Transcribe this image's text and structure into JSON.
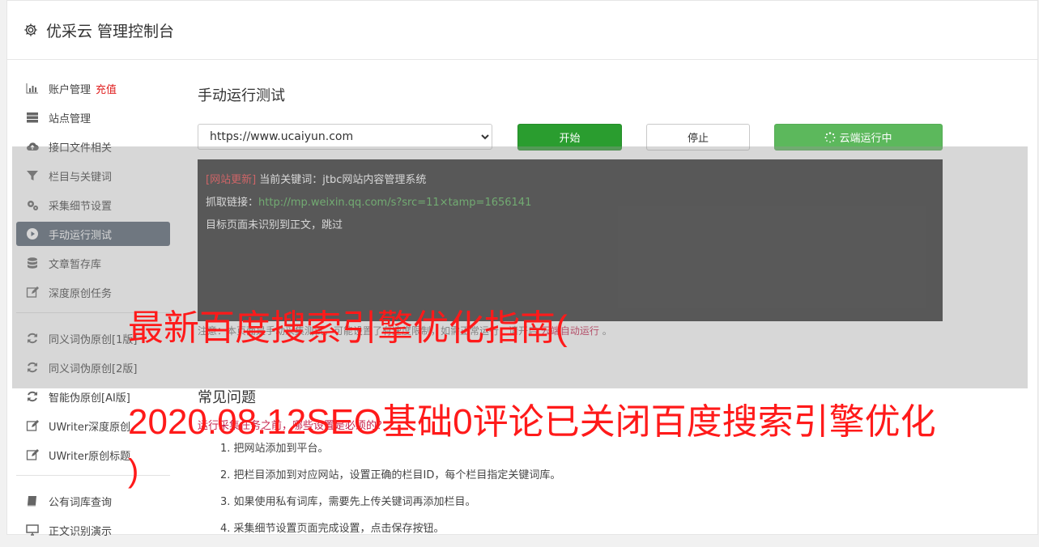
{
  "header": {
    "title": "优采云 管理控制台"
  },
  "sidebar": {
    "group1": [
      {
        "label": "账户管理",
        "extra": "充值",
        "icon": "bar-chart-icon"
      },
      {
        "label": "站点管理",
        "icon": "server-icon"
      },
      {
        "label": "接口文件相关",
        "icon": "cloud-upload-icon"
      },
      {
        "label": "栏目与关键词",
        "icon": "filter-icon"
      },
      {
        "label": "采集细节设置",
        "icon": "gears-icon"
      },
      {
        "label": "手动运行测试",
        "icon": "play-circle-icon",
        "active": true
      },
      {
        "label": "文章暂存库",
        "icon": "database-icon"
      },
      {
        "label": "深度原创任务",
        "icon": "edit-icon"
      }
    ],
    "group2": [
      {
        "label": "同义词伪原创[1版]",
        "icon": "refresh-icon"
      },
      {
        "label": "同义词伪原创[2版]",
        "icon": "refresh-icon"
      },
      {
        "label": "智能伪原创[AI版]",
        "icon": "refresh-icon"
      },
      {
        "label": "UWriter深度原创",
        "icon": "edit-icon"
      },
      {
        "label": "UWriter原创标题",
        "icon": "edit-icon"
      }
    ],
    "group3": [
      {
        "label": "公有词库查询",
        "icon": "book-icon"
      },
      {
        "label": "正文识别演示",
        "icon": "monitor-icon"
      }
    ]
  },
  "main": {
    "title": "手动运行测试",
    "site_select": {
      "value": "https://www.ucaiyun.com",
      "options": [
        "https://www.ucaiyun.com"
      ]
    },
    "buttons": {
      "start": "开始",
      "stop": "停止",
      "cloud": "云端运行中"
    },
    "console": {
      "line1_tag": "[网站更新]",
      "line1_text": " 当前关键词：jtbc网站内容管理系统",
      "line2_label": "抓取链接：",
      "line2_link": "http://mp.weixin.qq.com/s?src=11×tamp=1656141",
      "line3": "目标页面未识别到正文，跳过"
    },
    "note": {
      "prefix": "注意：",
      "text": "本页面是手动采集测试，可能设置了有速度限制，如需正常运行，请开启",
      "link": "云端自动运行",
      "suffix": " 。"
    },
    "faq": {
      "title": "常见问题",
      "question": "运行采集任务之前，哪些设置是必须的？",
      "items": [
        "1. 把网站添加到平台。",
        "2. 把栏目添加到对应网站，设置正确的栏目ID，每个栏目指定关键词库。",
        "3. 如果使用私有词库，需要先上传关键词再添加栏目。",
        "4. 采集细节设置页面完成设置，点击保存按钮。"
      ]
    }
  },
  "overlay": {
    "line1": "最新百度搜索引擎优化指南(",
    "line2": "2020.08.12SEO基础0评论已关闭百度搜索引擎优化",
    "line3": ")"
  },
  "colors": {
    "active_nav": "#586473",
    "start_btn": "#2a9d2f",
    "cloud_btn": "#5cb85c",
    "console_bg": "#333333",
    "overlay_text": "#ff1a1a"
  }
}
